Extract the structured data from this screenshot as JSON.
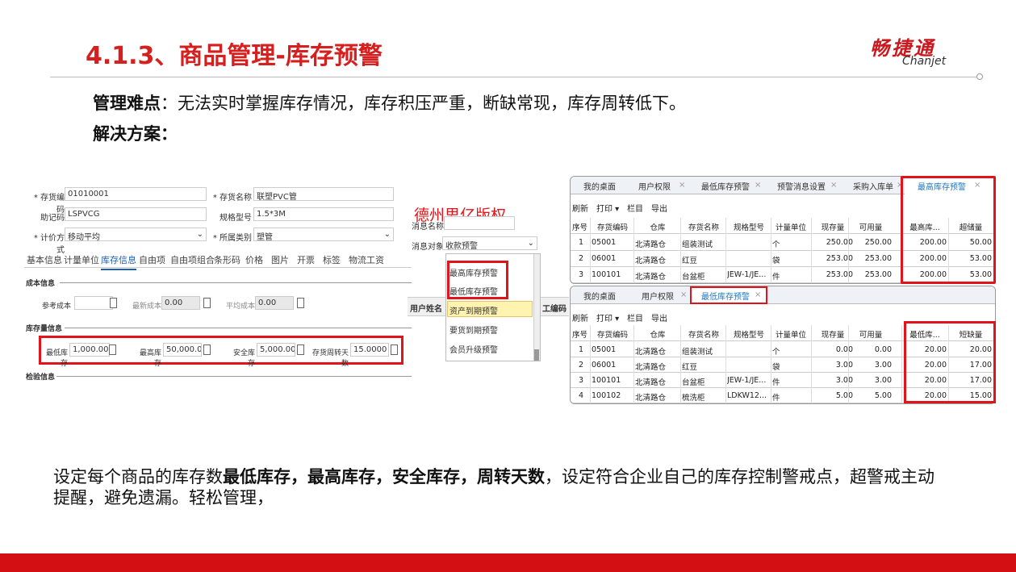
{
  "slide": {
    "title": "4.1.3、商品管理-库存预警",
    "logo_cn": "畅捷通",
    "logo_en": "Chanjet",
    "difficulty_label": "管理难点",
    "difficulty_text": "：无法实时掌握库存情况，库存积压严重，断缺常现，库存周转低下。",
    "solution_label": "解决方案：",
    "bottom_pre": "设定每个商品的库存数",
    "bottom_bold": "最低库存，最高库存，安全库存，周转天数",
    "bottom_post": "，设定符合企业自己的库存控制警戒点，超警戒主动提醒，避免遗漏。轻松管理，",
    "watermark": "德州思亿版权"
  },
  "form": {
    "code_label": "* 存货编码",
    "code_value": "01010001",
    "name_label": "* 存货名称",
    "name_value": "联塑PVC管",
    "mnemonic_label": "助记码",
    "mnemonic_value": "LSPVCG",
    "spec_label": "规格型号",
    "spec_value": "1.5*3M",
    "valuation_label": "* 计价方式",
    "valuation_value": "移动平均",
    "category_label": "* 所属类别",
    "category_value": "塑管",
    "tabs": [
      "基本信息",
      "计量单位",
      "库存信息",
      "自由项",
      "自由项组合",
      "条形码",
      "价格",
      "图片",
      "开票",
      "标签",
      "物流工资"
    ],
    "cost_section": "成本信息",
    "ref_cost_label": "参考成本",
    "latest_cost_label": "最新成本",
    "latest_cost_value": "0.00",
    "avg_cost_label": "平均成本",
    "avg_cost_value": "0.00",
    "stock_section": "库存量信息",
    "min_label": "最低库存",
    "min_value": "1,000.00",
    "max_label": "最高库存",
    "max_value": "50,000.00",
    "safe_label": "安全库存",
    "safe_value": "5,000.00",
    "days_label": "存货周转天数",
    "days_value": "15.0000",
    "check_section": "检验信息"
  },
  "popup": {
    "msg_name_label": "消息名称",
    "msg_target_label": "消息对象",
    "msg_target_value": "收款预警",
    "user_col": "用户姓名",
    "code_col": "工编码",
    "options": [
      "最高库存预警",
      "最低库存预警",
      "资产到期预警",
      "要货到期预警",
      "会员升级预警"
    ]
  },
  "grid_top": {
    "tabs": [
      "我的桌面",
      "用户权限",
      "最低库存预警",
      "预警消息设置",
      "采购入库单",
      "最高库存预警"
    ],
    "toolbar": [
      "刷新",
      "打印 ▾",
      "栏目",
      "导出"
    ],
    "headers": [
      "序号",
      "存货编码",
      "仓库",
      "存货名称",
      "规格型号",
      "计量单位",
      "现存量",
      "可用量",
      "最高库...",
      "超储量"
    ],
    "rows": [
      [
        "1",
        "05001",
        "北清路仓",
        "组装测试",
        "",
        "个",
        "250.00",
        "250.00",
        "200.00",
        "50.00"
      ],
      [
        "2",
        "06001",
        "北清路仓",
        "红豆",
        "",
        "袋",
        "253.00",
        "253.00",
        "200.00",
        "53.00"
      ],
      [
        "3",
        "100101",
        "北清路仓",
        "台盆柜",
        "JEW-1/JE...",
        "件",
        "253.00",
        "253.00",
        "200.00",
        "53.00"
      ]
    ]
  },
  "grid_bottom": {
    "tabs": [
      "我的桌面",
      "用户权限",
      "最低库存预警"
    ],
    "toolbar": [
      "刷新",
      "打印 ▾",
      "栏目",
      "导出"
    ],
    "headers": [
      "序号",
      "存货编码",
      "仓库",
      "存货名称",
      "规格型号",
      "计量单位",
      "现存量",
      "可用量",
      "最低库...",
      "短缺量"
    ],
    "rows": [
      [
        "1",
        "05001",
        "北清路仓",
        "组装测试",
        "",
        "个",
        "0.00",
        "0.00",
        "20.00",
        "20.00"
      ],
      [
        "2",
        "06001",
        "北清路仓",
        "红豆",
        "",
        "袋",
        "3.00",
        "3.00",
        "20.00",
        "17.00"
      ],
      [
        "3",
        "100101",
        "北清路仓",
        "台盆柜",
        "JEW-1/JE...",
        "件",
        "3.00",
        "3.00",
        "20.00",
        "17.00"
      ],
      [
        "4",
        "100102",
        "北清路仓",
        "梳洗柜",
        "LDKW12...",
        "件",
        "5.00",
        "5.00",
        "20.00",
        "15.00"
      ]
    ]
  },
  "colors": {
    "accent_red": "#d6201f",
    "bar_red": "#d40f14",
    "link_blue": "#1a78c2"
  }
}
